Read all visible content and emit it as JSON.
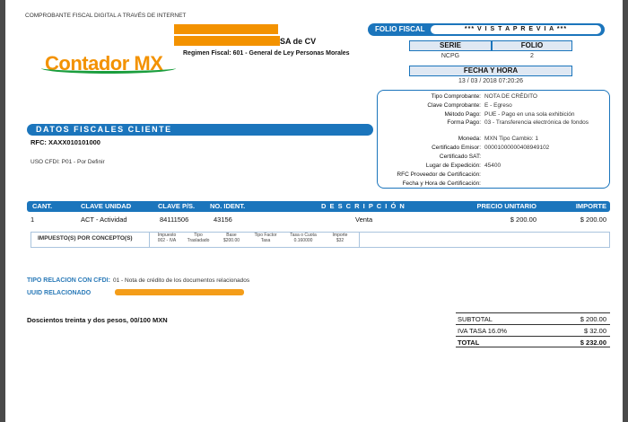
{
  "header": {
    "comprobante_label": "COMPROBANTE FISCAL DIGITAL A TRAVÉS DE INTERNET",
    "emisor_name_suffix": "SA de CV",
    "regimen": "Regimen Fiscal:  601 - General de Ley Personas Morales",
    "logo_text": "Contador MX"
  },
  "folio_fiscal": {
    "label": "FOLIO FISCAL",
    "value": "*** V I S T A   P R E V I A ***",
    "serie_label": "SERIE",
    "folio_label": "FOLIO",
    "serie": "NCPG",
    "folio": "2",
    "fecha_label": "FECHA Y HORA",
    "fecha": "13 / 03 / 2018  07:20:26"
  },
  "info": {
    "tipo_comprobante_label": "Tipo Comprobante:",
    "tipo_comprobante": "NOTA DE CRÉDITO",
    "clave_comprobante_label": "Clave Comprobante:",
    "clave_comprobante": "E - Egreso",
    "metodo_pago_label": "Método Pago:",
    "metodo_pago": "PUE - Pago en una sola exhibición",
    "forma_pago_label": "Forma Pago:",
    "forma_pago": "03 - Transferencia electrónica de fondos",
    "moneda_label": "Moneda:",
    "moneda": "MXN   Tipo Cambio:  1",
    "cert_emisor_label": "Certificado Emisor:",
    "cert_emisor": "00001000000408949102",
    "cert_sat_label": "Certificado SAT:",
    "cert_sat": "",
    "lugar_label": "Lugar de Expedición:",
    "lugar": "45400",
    "rfc_prov_label": "RFC Proveedor de Certificación:",
    "fecha_cert_label": "Fecha y Hora de Certificación:"
  },
  "cliente": {
    "title": "DATOS FISCALES CLIENTE",
    "rfc": "RFC: XAXX010101000",
    "uso_cfdi": "USO CFDI:   P01 - Por Definir"
  },
  "concepts": {
    "headers": [
      "CANT.",
      "CLAVE UNIDAD",
      "CLAVE P/S.",
      "NO. IDENT.",
      "D E S C R I P C I Ó N",
      "PRECIO UNITARIO",
      "IMPORTE"
    ],
    "row": {
      "cant": "1",
      "unidad": "ACT - Actividad",
      "clave": "84111506",
      "ident": "43156",
      "descripcion": "Venta",
      "precio": "$ 200.00",
      "importe": "$ 200.00"
    },
    "impuesto_label": "IMPUESTO(S) POR CONCEPTO(S)",
    "impuesto_headers": [
      "Impuesto",
      "Tipo",
      "Base",
      "Tipo Factor",
      "Tasa o Cuota",
      "Importe"
    ],
    "impuesto_values": [
      "002 - IVA",
      "Trasladado",
      "$200.00",
      "Tasa",
      "0.160000",
      "$32"
    ]
  },
  "relacion": {
    "tipo_label": "TIPO RELACION CON CFDI:",
    "tipo_value": "01 - Nota de crédito de los documentos relacionados",
    "uuid_label": "UUID RELACIONADO"
  },
  "totals": {
    "letra": "Doscientos treinta y dos pesos, 00/100 MXN",
    "subtotal_label": "SUBTOTAL",
    "subtotal": "$ 200.00",
    "iva_label": "IVA TASA 16.0%",
    "iva": "$ 32.00",
    "total_label": "TOTAL",
    "total": "$ 232.00"
  },
  "colors": {
    "accent": "#1b75bc",
    "logo_orange": "#f39200",
    "logo_green": "#1b9e3e",
    "redaction": "#f39200"
  }
}
